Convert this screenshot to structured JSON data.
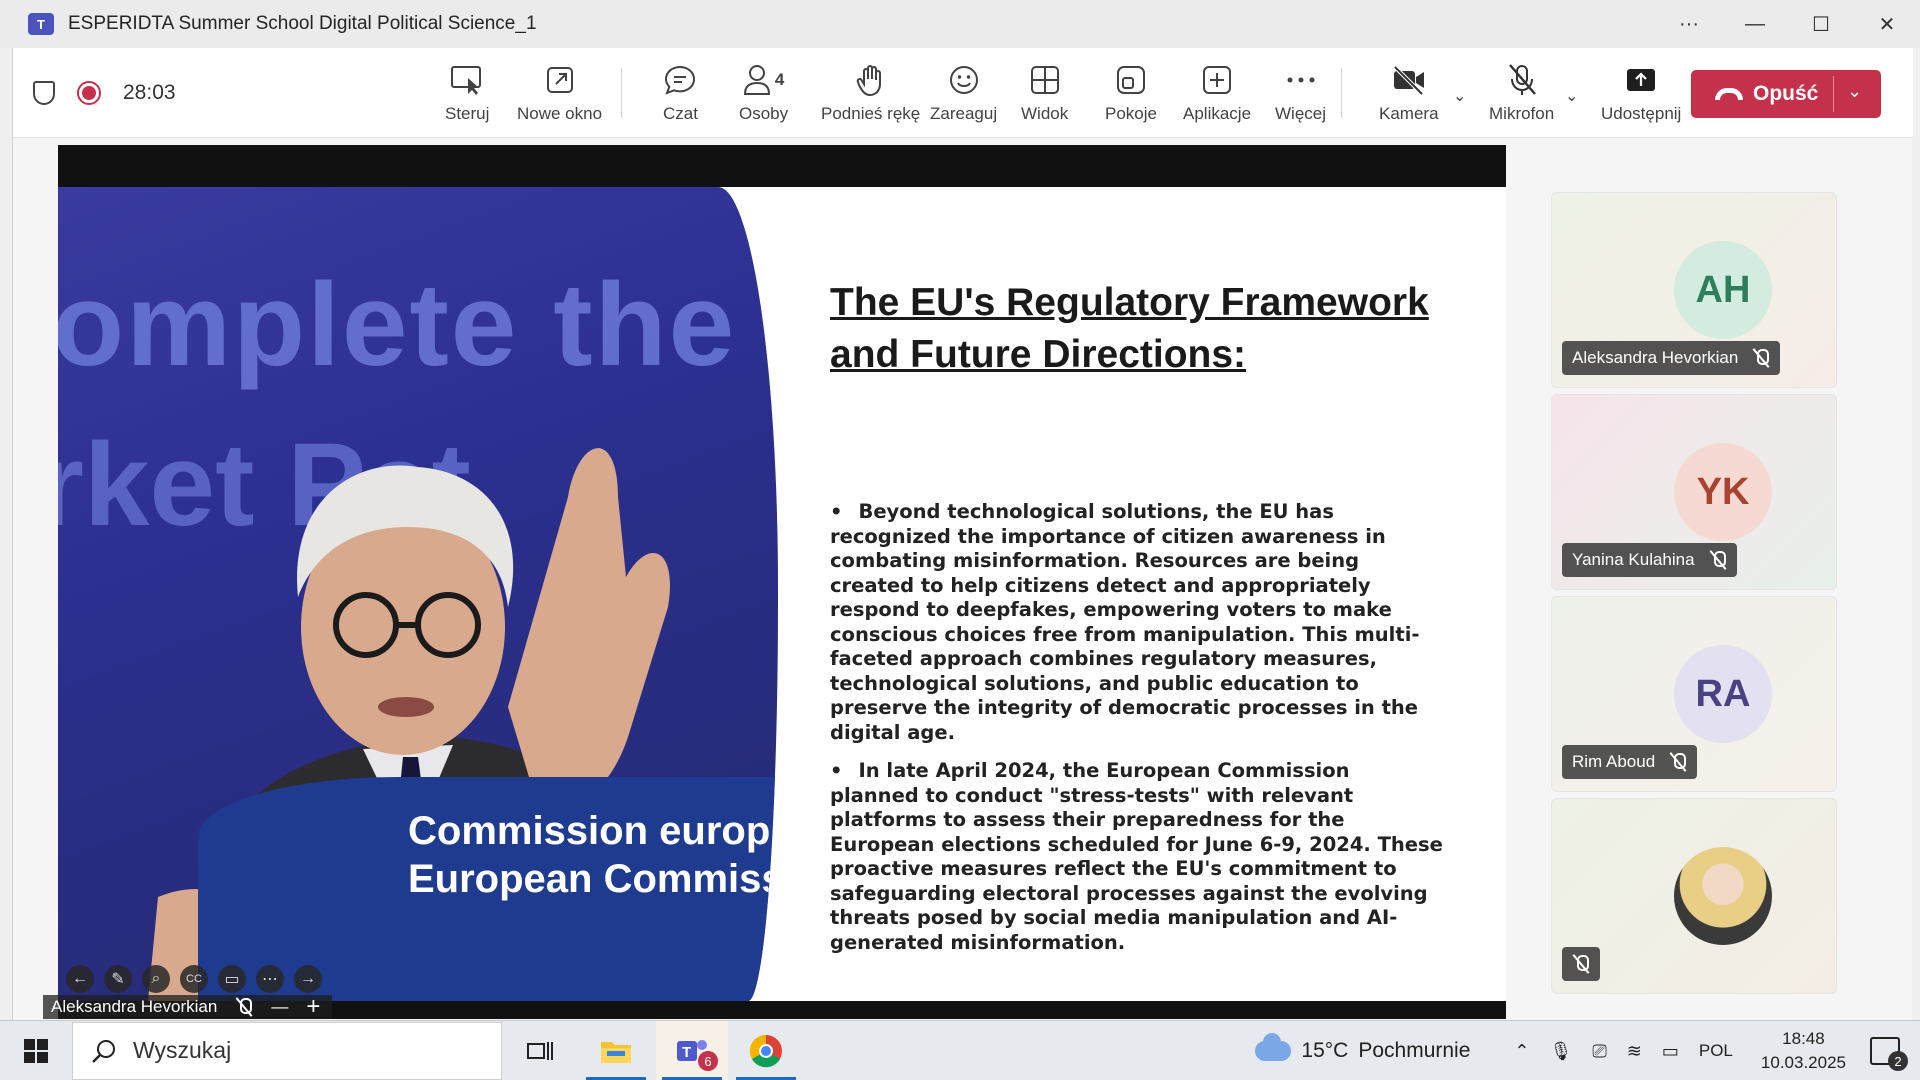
{
  "window": {
    "title": "ESPERIDTA Summer School Digital Political Science_1",
    "controls": {
      "more": "···",
      "minimize": "—",
      "maximize": "☐",
      "close": "✕"
    }
  },
  "meeting": {
    "timer": "28:03",
    "participants_count": "4",
    "toolbar": {
      "steruj": "Steruj",
      "nowe_okno": "Nowe okno",
      "czat": "Czat",
      "osoby": "Osoby",
      "podnies_reke": "Podnieś rękę",
      "zareaguj": "Zareaguj",
      "widok": "Widok",
      "pokoje": "Pokoje",
      "aplikacje": "Aplikacje",
      "wiecej": "Więcej",
      "kamera": "Kamera",
      "mikrofon": "Mikrofon",
      "udostepnij": "Udostępnij",
      "opusc": "Opuść"
    },
    "accent_color": "#c4314b"
  },
  "slide": {
    "title": "The EU's Regulatory Framework and Future Directions:",
    "photo_text_top": "omplete the",
    "photo_text_middle": "rket Pat",
    "podium_line1": "Commission europ",
    "podium_line2": "European Commiss",
    "bullets": [
      "Beyond technological solutions, the EU has recognized the importance of citizen awareness in combating misinformation. Resources are being created to help citizens detect and appropriately respond to deepfakes, empowering voters to make conscious choices free from manipulation. This multi-faceted approach combines regulatory measures, technological solutions, and public education to preserve the integrity of democratic processes in the digital age.",
      "In late April 2024, the European Commission planned to conduct \"stress-tests\" with relevant platforms to assess their preparedness for the European elections scheduled for June 6-9, 2024. These proactive measures reflect the EU's commitment to safeguarding electoral processes against the evolving threats posed by social media manipulation and AI-generated misinformation."
    ],
    "presenter_name": "Aleksandra Hevorkian",
    "zoom_out": "—",
    "zoom_in": "+"
  },
  "participants": [
    {
      "initials": "AH",
      "name": "Aleksandra Hevorkian",
      "avatar_color": "#d6efe3",
      "text_color": "#2e7d5b",
      "bg": "#f2f1e8"
    },
    {
      "initials": "YK",
      "name": "Yanina Kulahina",
      "avatar_color": "#f7dcd6",
      "text_color": "#a8432f",
      "bg": "#f3e6ee"
    },
    {
      "initials": "RA",
      "name": "Rim Aboud",
      "avatar_color": "#e5e2f2",
      "text_color": "#4a4280",
      "bg": "#f1f0ea"
    },
    {
      "initials": "",
      "name": "",
      "avatar_color": "#d9c7a8",
      "text_color": "#333",
      "bg": "#eef1e8"
    }
  ],
  "taskbar": {
    "search_placeholder": "Wyszukaj",
    "teams_badge": "6",
    "weather_temp": "15°C",
    "weather_desc": "Pochmurnie",
    "language": "POL",
    "time": "18:48",
    "date": "10.03.2025",
    "notification_count": "2"
  }
}
